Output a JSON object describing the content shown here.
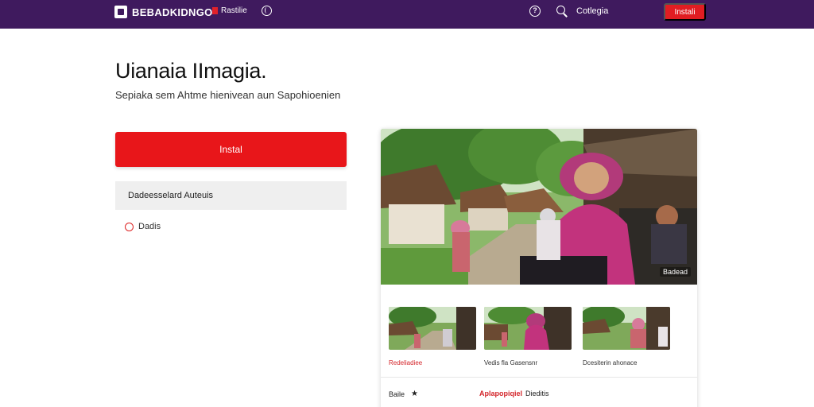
{
  "header": {
    "logo_text": "BEBADKIDNGO",
    "nav_item_label": "Rastilie",
    "help_glyph": "?",
    "link_label": "Cotlegia",
    "install_label": "Instali"
  },
  "hero": {
    "title": "Uianaia IImagia.",
    "subtitle": "Sepiaka sem Ahtme hienivean aun Sapohioenien"
  },
  "left": {
    "install_button": "Instal",
    "info_row": "Dadeesselard Auteuis",
    "radio_label": "Dadis"
  },
  "card": {
    "hero_badge": "Badead",
    "thumbnails": [
      {
        "caption": "Redeliadiee"
      },
      {
        "caption": "Vedis fla Gasensnr"
      },
      {
        "caption": "Dcesiterin ahonace"
      }
    ],
    "rating_label": "Baile",
    "app_label": "Aplapopiqiel",
    "app_label_extra": "Dieditis"
  },
  "colors": {
    "topbar": "#3f1a5e",
    "accent_red": "#e8161a"
  }
}
